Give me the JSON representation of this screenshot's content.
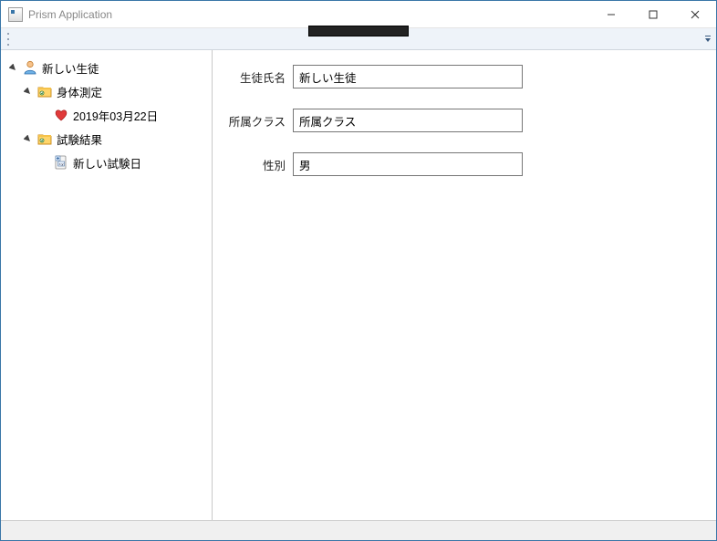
{
  "window": {
    "title": "Prism Application"
  },
  "tree": {
    "root": {
      "label": "新しい生徒",
      "children": [
        {
          "label": "身体測定",
          "children": [
            {
              "label": "2019年03月22日"
            }
          ]
        },
        {
          "label": "試験結果",
          "children": [
            {
              "label": "新しい試験日"
            }
          ]
        }
      ]
    }
  },
  "form": {
    "name_label": "生徒氏名",
    "name_value": "新しい生徒",
    "class_label": "所属クラス",
    "class_value": "所属クラス",
    "gender_label": "性別",
    "gender_value": "男"
  }
}
